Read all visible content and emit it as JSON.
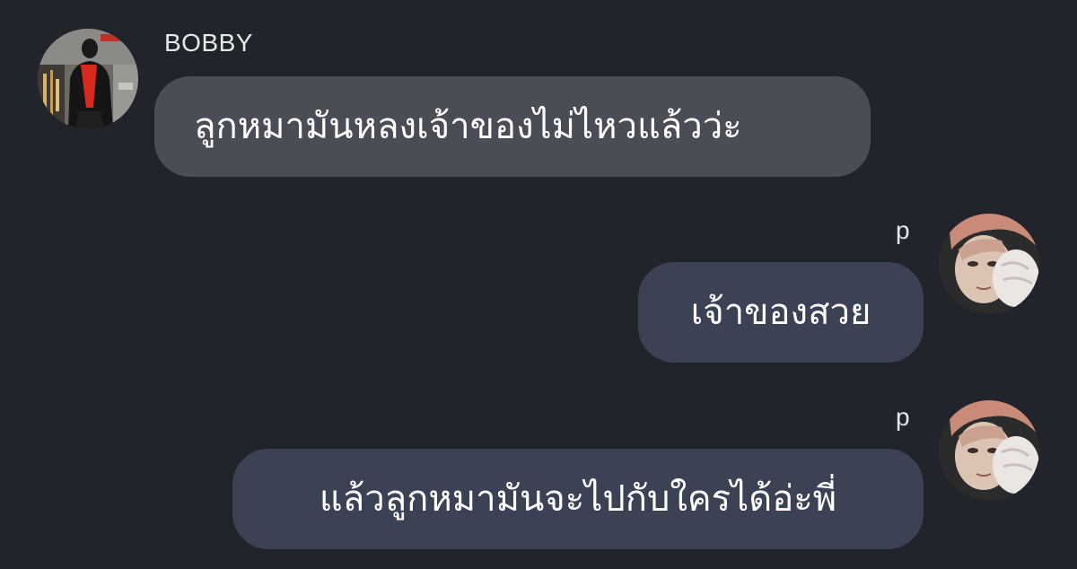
{
  "colors": {
    "background": "#22242c",
    "incoming_bubble": "#4a4d56",
    "outgoing_bubble": "#3b4253",
    "text": "#ffffff"
  },
  "messages": [
    {
      "direction": "incoming",
      "sender": "BOBBY",
      "avatar_icon": "profile-photo-man-red-shirt-icon",
      "text": "ลูกหมามันหลงเจ้าของไม่ไหวแล้วว่ะ"
    },
    {
      "direction": "outgoing",
      "sender": "p",
      "avatar_icon": "profile-photo-face-icon",
      "text": "เจ้าของสวย"
    },
    {
      "direction": "outgoing",
      "sender": "p",
      "avatar_icon": "profile-photo-face-icon",
      "text": "แล้วลูกหมามันจะไปกับใครได้อ่ะพี่"
    }
  ]
}
